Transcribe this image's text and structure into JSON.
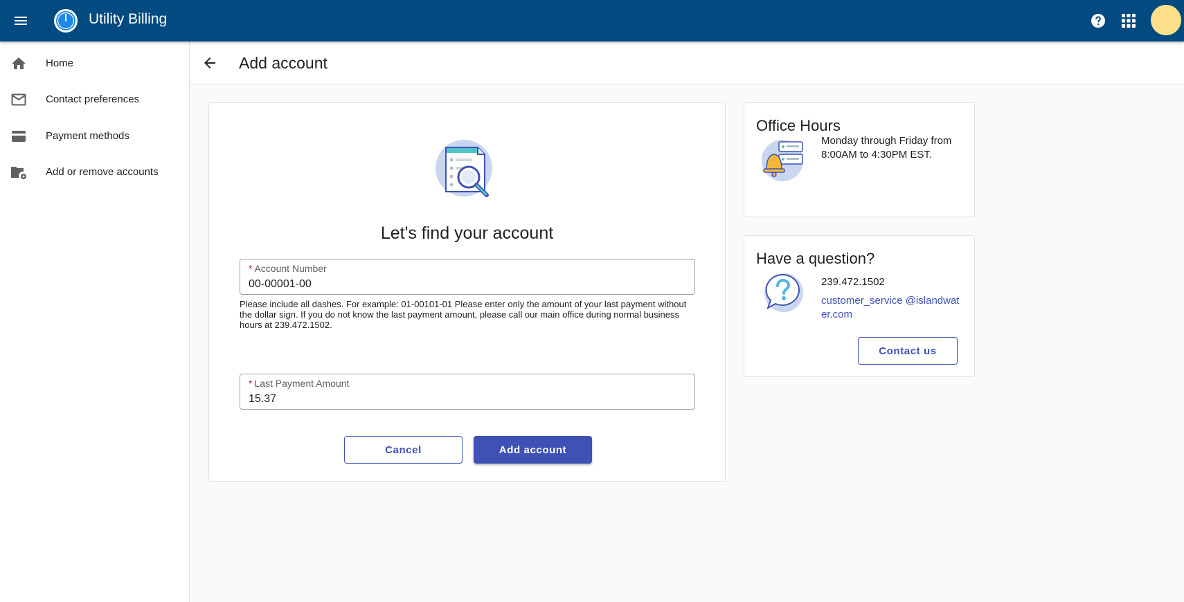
{
  "app": {
    "title": "Utility Billing"
  },
  "topbar": {
    "menu_icon": "menu-icon",
    "logo_icon": "gauge-logo-icon",
    "help_icon": "help-icon",
    "apps_icon": "apps-grid-icon",
    "avatar_color": "#fde089",
    "bar_color": "#024a80"
  },
  "sidebar": {
    "items": [
      {
        "label": "Home",
        "icon": "home-icon"
      },
      {
        "label": "Contact preferences",
        "icon": "mail-icon"
      },
      {
        "label": "Payment methods",
        "icon": "credit-card-icon"
      },
      {
        "label": "Add or remove accounts",
        "icon": "folder-settings-icon"
      }
    ]
  },
  "header": {
    "title": "Add account",
    "back_icon": "arrow-back-icon"
  },
  "form": {
    "heading": "Let's find your account",
    "account_number": {
      "label": "Account Number",
      "required_mark": "*",
      "value": "00-00001-00"
    },
    "hint": "Please include all dashes. For example: 01-00101-01 Please enter only the amount of your last payment without the dollar sign. If you do not know the last payment amount, please call our main office during normal business hours at 239.472.1502.",
    "last_payment": {
      "label": "Last Payment Amount",
      "required_mark": "*",
      "value": "15.37"
    },
    "cancel_label": "Cancel",
    "submit_label": "Add account"
  },
  "office_hours": {
    "title": "Office Hours",
    "text": "Monday through Friday from 8:00AM to 4:30PM EST."
  },
  "question": {
    "title": "Have a question?",
    "phone": "239.472.1502",
    "email": "customer_service @islandwater.com",
    "contact_label": "Contact us"
  },
  "colors": {
    "primary": "#3f51b5",
    "required": "#c62828"
  }
}
